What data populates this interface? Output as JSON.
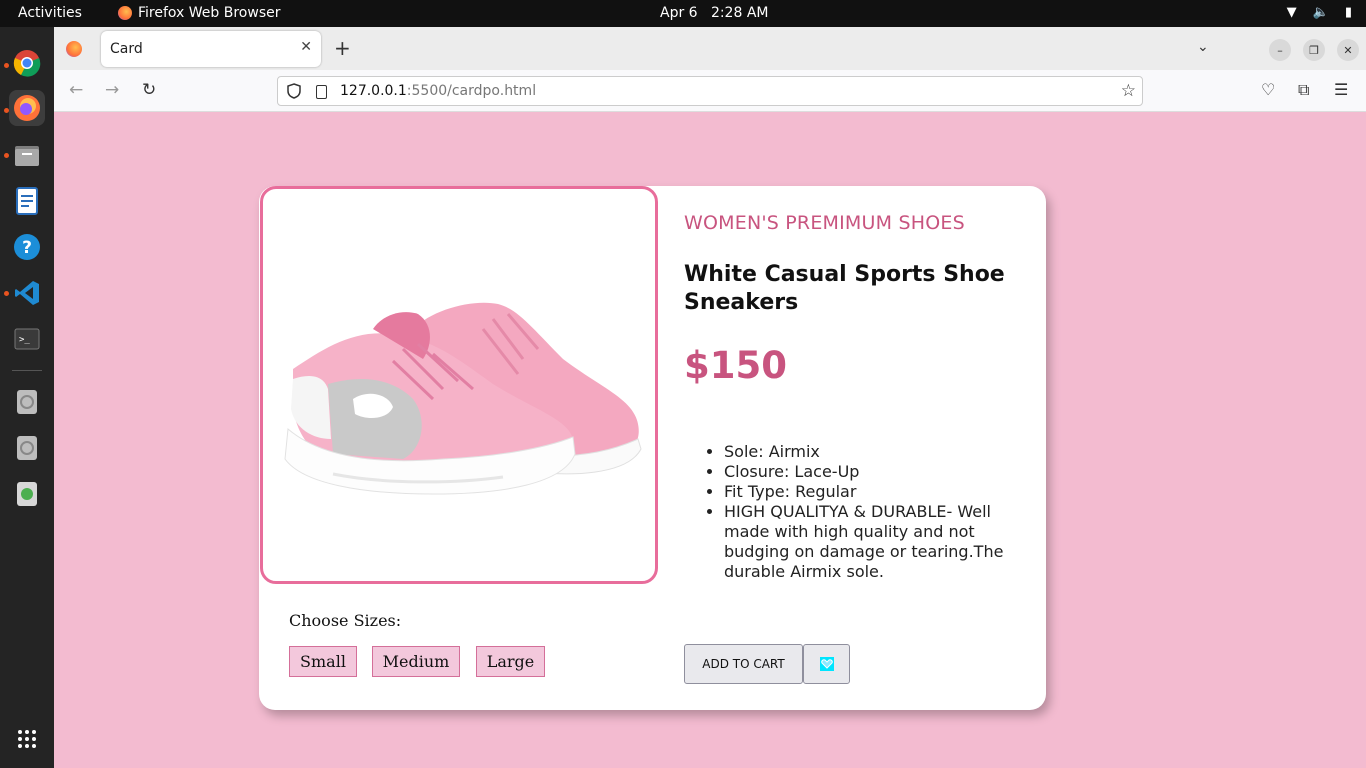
{
  "system_bar": {
    "activities": "Activities",
    "app_name": "Firefox Web Browser",
    "date": "Apr 6",
    "time": "2:28 AM"
  },
  "dock": {
    "items": [
      "chrome-icon",
      "firefox-icon",
      "files-icon",
      "writer-icon",
      "help-icon",
      "vscode-icon",
      "terminal-icon",
      "disk-icon",
      "disk-icon",
      "trash-icon",
      "apps-grid-icon"
    ]
  },
  "browser": {
    "tab_title": "Card",
    "url_host": "127.0.0.1",
    "url_rest": ":5500/cardpo.html"
  },
  "product": {
    "category": "WOMEN'S PREMIMUM SHOES",
    "title": "White Casual Sports Shoe Sneakers",
    "price": "$150",
    "features": [
      "Sole: Airmix",
      "Closure: Lace-Up",
      "Fit Type: Regular",
      "HIGH QUALITYA & DURABLE- Well made with high quality and not budging on damage or tearing.The durable Airmix sole."
    ],
    "sizes_label": "Choose Sizes:",
    "sizes": [
      "Small",
      "Medium",
      "Large"
    ],
    "add_to_cart": "ADD TO CART",
    "icon_button": "heart-icon"
  },
  "colors": {
    "page_bg": "#f3bbd0",
    "accent": "#c8547f",
    "image_border": "#e86d9b"
  }
}
